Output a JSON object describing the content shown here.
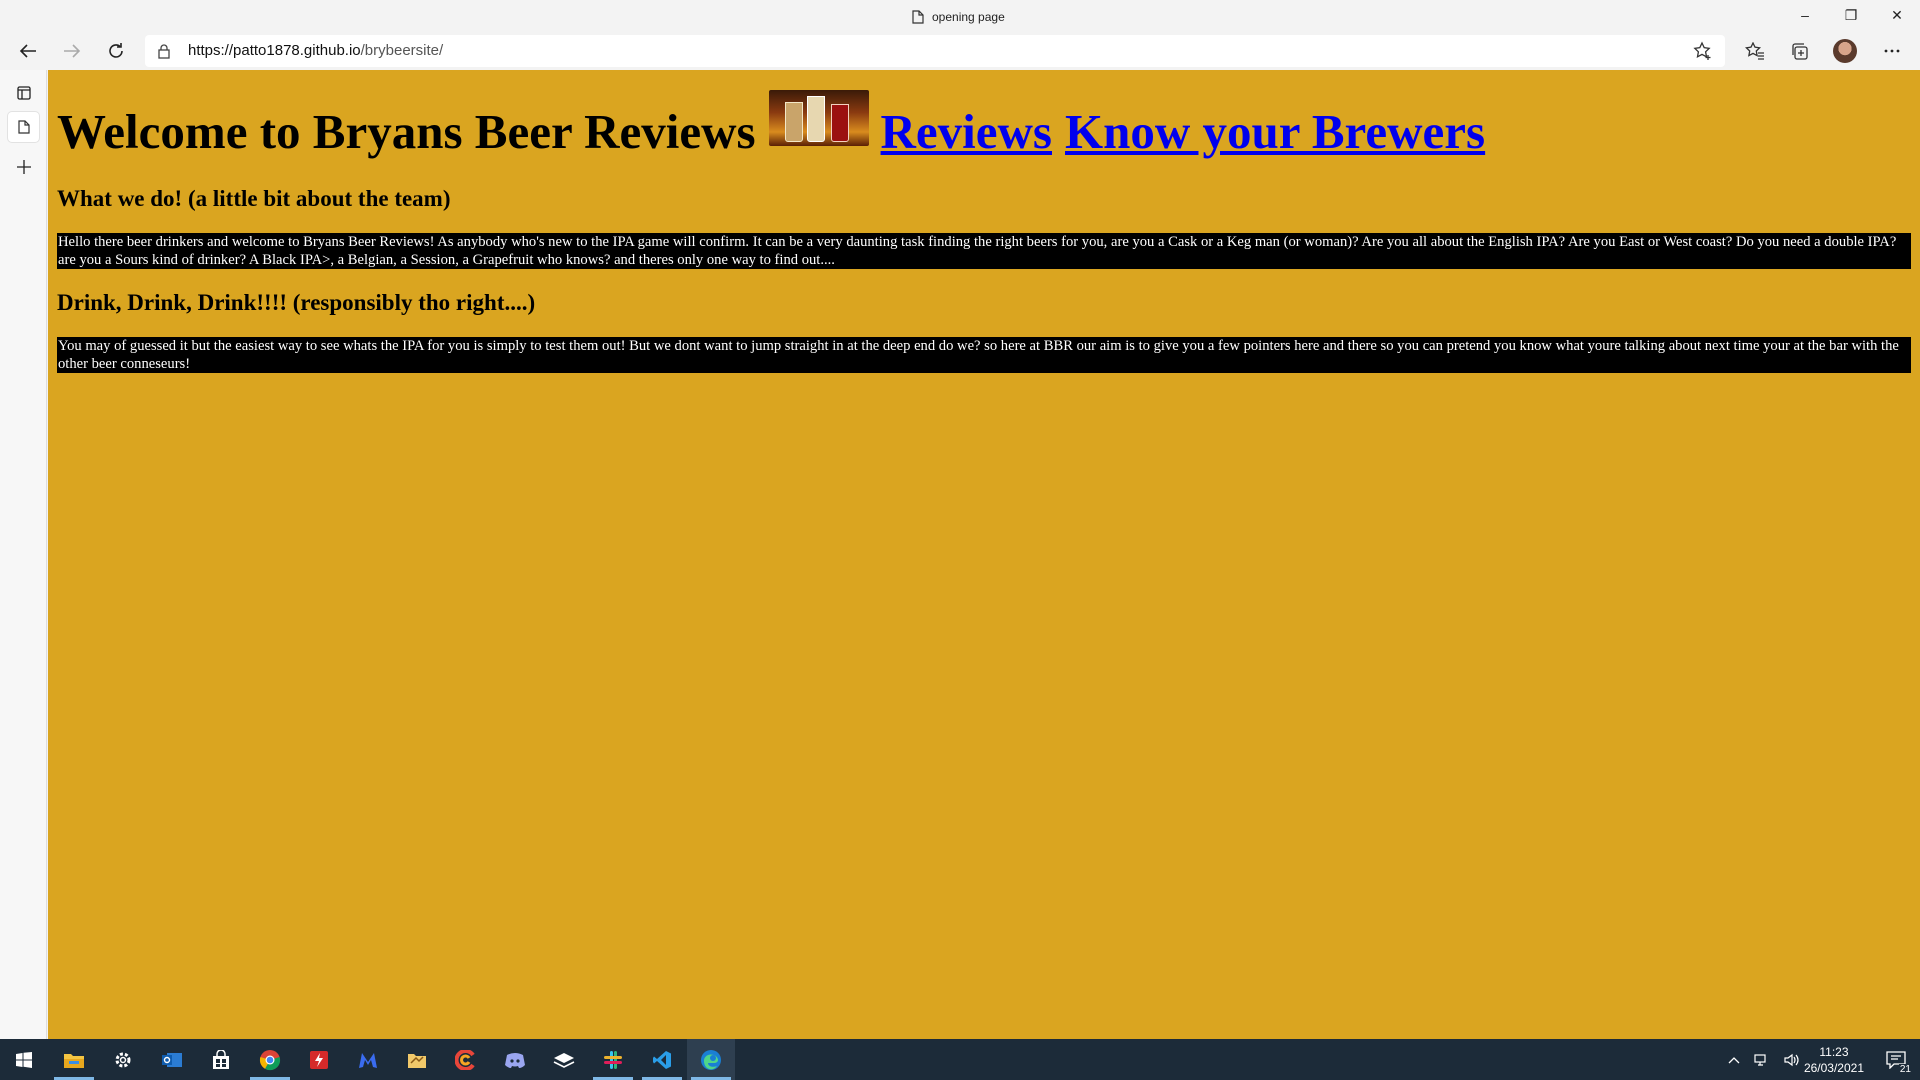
{
  "browser": {
    "tab_title": "opening page",
    "url_host": "https://patto1878.github.io",
    "url_path": "/brybeersite/",
    "icons": [
      "back-icon",
      "forward-icon",
      "refresh-icon",
      "lock-icon",
      "add-favorite-icon",
      "favorites-icon",
      "collections-icon",
      "profile-avatar",
      "more-icon"
    ]
  },
  "window_controls": {
    "minimize": "–",
    "restore": "❐",
    "close": "✕"
  },
  "sidebar": {
    "icons": [
      "tab-actions-icon",
      "page-tab-icon",
      "new-tab-icon"
    ]
  },
  "page": {
    "background": "#daa520",
    "heading": "Welcome to Bryans Beer Reviews",
    "links": [
      {
        "label": "Reviews"
      },
      {
        "label": "Know your Brewers"
      }
    ],
    "sections": [
      {
        "title": "What we do! (a little bit about the team)",
        "body": "Hello there beer drinkers and welcome to Bryans Beer Reviews! As anybody who's new to the IPA game will confirm. It can be a very daunting task finding the right beers for you, are you a Cask or a Keg man (or woman)? Are you all about the English IPA? Are you East or West coast? Do you need a double IPA? are you a Sours kind of drinker? A Black IPA>, a Belgian, a Session, a Grapefruit who knows? and theres only one way to find out...."
      },
      {
        "title": "Drink, Drink, Drink!!!! (responsibly tho right....)",
        "body": "You may of guessed it but the easiest way to see whats the IPA for you is simply to test them out! But we dont want to jump straight in at the deep end do we? so here at BBR our aim is to give you a few pointers here and there so you can pretend you know what youre talking about next time your at the bar with the other beer conneseurs!"
      }
    ]
  },
  "taskbar": {
    "apps": [
      "windows-start-icon",
      "file-explorer-icon",
      "settings-icon",
      "outlook-icon",
      "store-icon",
      "chrome-icon",
      "flash-app-icon",
      "malwarebytes-icon",
      "folder-app-icon",
      "ccleaner-icon",
      "discord-icon",
      "layers-app-icon",
      "slack-icon",
      "vscode-icon",
      "edge-icon"
    ],
    "time": "11:23",
    "date": "26/03/2021",
    "notifications": "21"
  }
}
